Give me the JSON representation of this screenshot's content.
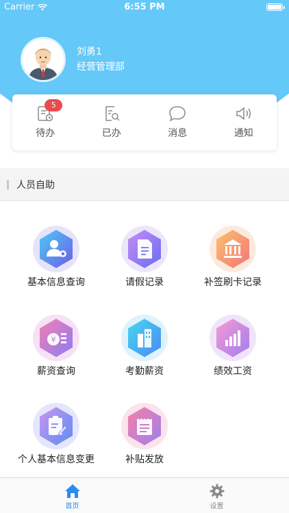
{
  "status_bar": {
    "carrier": "Carrier",
    "time": "6:55 PM"
  },
  "profile": {
    "name": "刘勇1",
    "department": "经营管理部"
  },
  "quick_actions": [
    {
      "label": "待办",
      "icon": "todo-icon",
      "badge": "5"
    },
    {
      "label": "已办",
      "icon": "done-icon"
    },
    {
      "label": "消息",
      "icon": "message-icon"
    },
    {
      "label": "通知",
      "icon": "speaker-icon"
    }
  ],
  "section": {
    "title": "人员自助"
  },
  "grid_items": [
    {
      "label": "基本信息查询",
      "icon": "user-info-icon"
    },
    {
      "label": "请假记录",
      "icon": "leave-record-icon"
    },
    {
      "label": "补签刷卡记录",
      "icon": "bank-icon"
    },
    {
      "label": "薪资查询",
      "icon": "salary-icon"
    },
    {
      "label": "考勤薪资",
      "icon": "attendance-icon"
    },
    {
      "label": "绩效工资",
      "icon": "performance-icon"
    },
    {
      "label": "个人基本信息变更",
      "icon": "edit-info-icon"
    },
    {
      "label": "补贴发放",
      "icon": "subsidy-icon"
    }
  ],
  "tabbar": [
    {
      "label": "首页",
      "icon": "home-icon",
      "active": true
    },
    {
      "label": "设置",
      "icon": "gear-icon",
      "active": false
    }
  ],
  "colors": {
    "header": "#64c8f8",
    "active_tab": "#2a8cf0",
    "inactive_tab": "#8a8a8a",
    "badge": "#e84c4c"
  }
}
